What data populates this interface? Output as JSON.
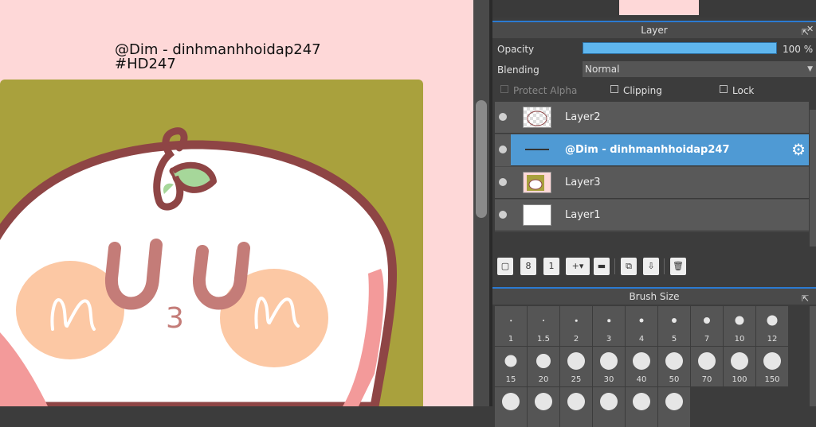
{
  "canvas": {
    "watermark_line1": "@Dim - dinhmanhhoidap247",
    "watermark_line2": "#HD247",
    "artwork_text": "3",
    "colors": {
      "background": "#fed8d8",
      "square": "#a9a13d",
      "face": "#ffffff",
      "outline": "#8e4545",
      "blush": "#fcc8a4",
      "features": "#c47c78",
      "leaf": "#a6d79a"
    }
  },
  "layer_panel": {
    "title": "Layer",
    "opacity_label": "Opacity",
    "opacity_value_text": "100 %",
    "opacity_percent": 100,
    "blending_label": "Blending",
    "blending_value": "Normal",
    "protect_alpha_label": "Protect Alpha",
    "clipping_label": "Clipping",
    "lock_label": "Lock",
    "layers": [
      {
        "name": "Layer2",
        "active": false
      },
      {
        "name": "@Dim - dinhmanhhoidap247",
        "active": true
      },
      {
        "name": "Layer3",
        "active": false
      },
      {
        "name": "Layer1",
        "active": false
      }
    ],
    "accent_color": "#4f9ad4"
  },
  "brush_panel": {
    "title": "Brush Size",
    "sizes": [
      "1",
      "1.5",
      "2",
      "3",
      "4",
      "5",
      "7",
      "10",
      "12",
      "15",
      "20",
      "25",
      "30",
      "40",
      "50",
      "70",
      "100",
      "150",
      "",
      "",
      "",
      "",
      "",
      ""
    ]
  },
  "icons": [
    "expand-icon",
    "close-icon",
    "gear-icon",
    "new-layer-icon",
    "new-8bit-layer-icon",
    "new-1bit-layer-icon",
    "add-layer-icon",
    "folder-icon",
    "duplicate-icon",
    "merge-icon",
    "delete-icon"
  ]
}
